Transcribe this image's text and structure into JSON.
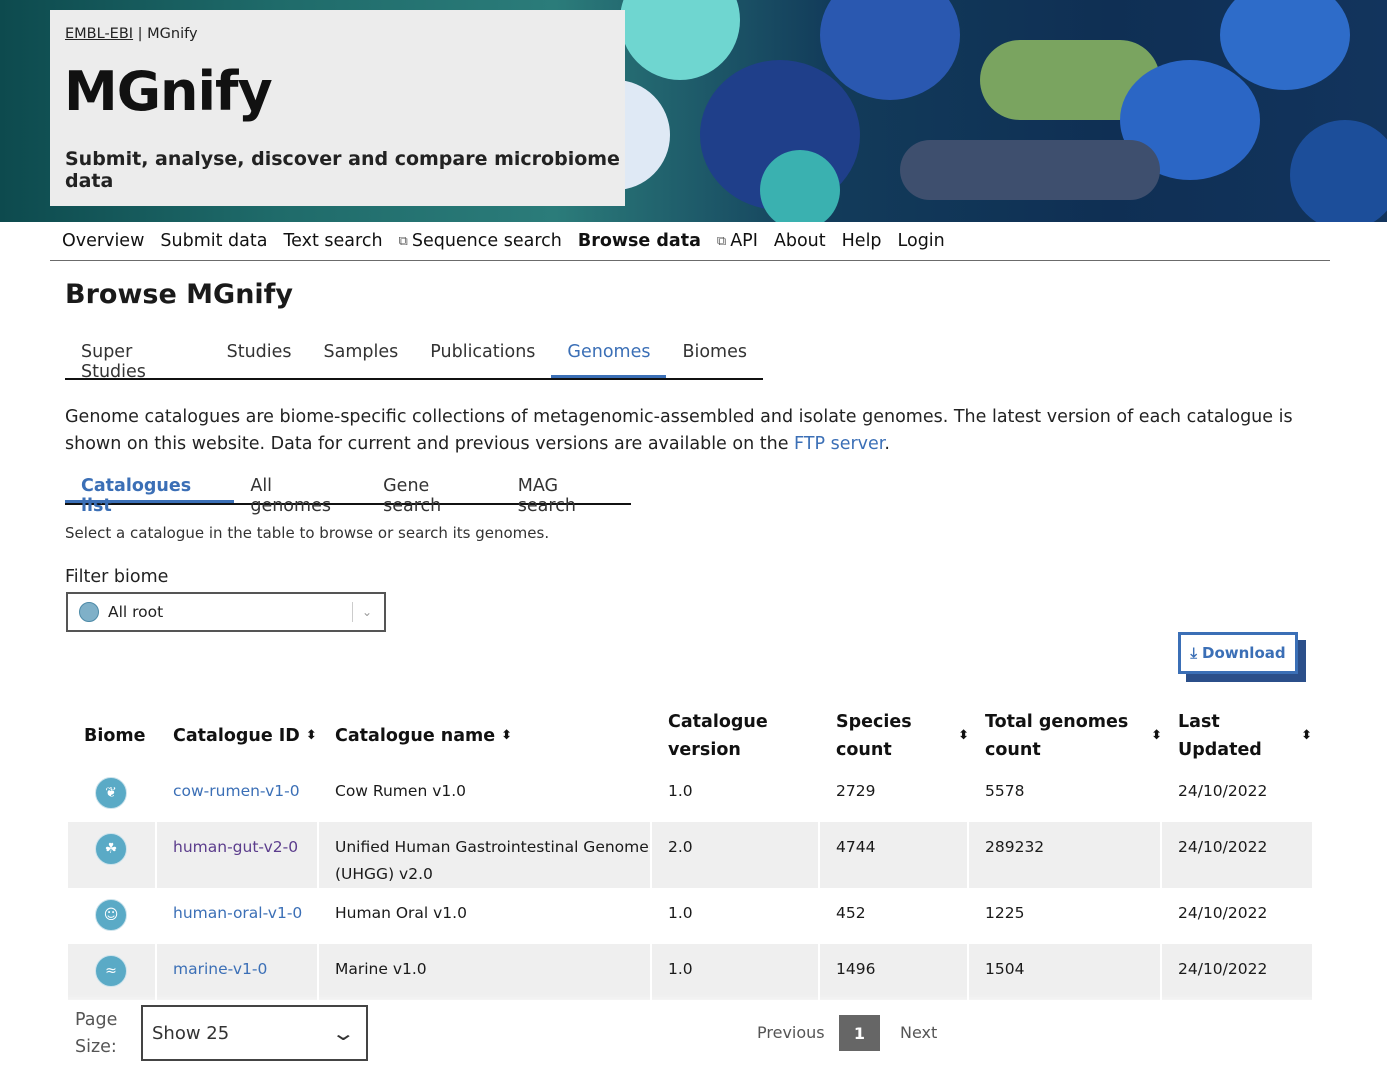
{
  "header": {
    "crumb_org": "EMBL-EBI",
    "crumb_sep": "|",
    "crumb_site": "MGnify",
    "logo_text": "MGnify",
    "tagline": "Submit, analyse, discover and compare microbiome data"
  },
  "nav": [
    {
      "label": "Overview",
      "external": false,
      "active": false
    },
    {
      "label": "Submit data",
      "external": false,
      "active": false
    },
    {
      "label": "Text search",
      "external": false,
      "active": false
    },
    {
      "label": "Sequence search",
      "external": true,
      "active": false
    },
    {
      "label": "Browse data",
      "external": false,
      "active": true
    },
    {
      "label": "API",
      "external": true,
      "active": false
    },
    {
      "label": "About",
      "external": false,
      "active": false
    },
    {
      "label": "Help",
      "external": false,
      "active": false
    },
    {
      "label": "Login",
      "external": false,
      "active": false
    }
  ],
  "page_title": "Browse MGnify",
  "tabs": [
    "Super Studies",
    "Studies",
    "Samples",
    "Publications",
    "Genomes",
    "Biomes"
  ],
  "active_tab": "Genomes",
  "intro": {
    "text": "Genome catalogues are biome-specific collections of metagenomic-assembled and isolate genomes. The latest version of each catalogue is shown on this website. Data for current and previous versions are available on the ",
    "link": "FTP server",
    "end": "."
  },
  "subtabs": [
    "Catalogues list",
    "All genomes",
    "Gene search",
    "MAG search"
  ],
  "active_subtab": "Catalogues list",
  "help_text": "Select a catalogue in the table to browse or search its genomes.",
  "filter": {
    "label": "Filter biome",
    "value": "All root"
  },
  "download_label": "Download",
  "table": {
    "headers": [
      {
        "label": "Biome",
        "sortable": false
      },
      {
        "label": "Catalogue ID",
        "sortable": true
      },
      {
        "label": "Catalogue name",
        "sortable": true
      },
      {
        "label": "Catalogue version",
        "sortable": false
      },
      {
        "label": "Species count",
        "sortable": true
      },
      {
        "label": "Total genomes count",
        "sortable": true
      },
      {
        "label": "Last Updated",
        "sortable": true
      }
    ],
    "rows": [
      {
        "biome_icon": "cow-icon",
        "id": "cow-rumen-v1-0",
        "name": "Cow Rumen v1.0",
        "version": "1.0",
        "species": "2729",
        "total": "5578",
        "updated": "24/10/2022"
      },
      {
        "biome_icon": "human-gut-icon",
        "id": "human-gut-v2-0",
        "name": "Unified Human Gastrointestinal Genome (UHGG) v2.0",
        "version": "2.0",
        "species": "4744",
        "total": "289232",
        "updated": "24/10/2022"
      },
      {
        "biome_icon": "human-oral-icon",
        "id": "human-oral-v1-0",
        "name": "Human Oral v1.0",
        "version": "1.0",
        "species": "452",
        "total": "1225",
        "updated": "24/10/2022"
      },
      {
        "biome_icon": "marine-icon",
        "id": "marine-v1-0",
        "name": "Marine v1.0",
        "version": "1.0",
        "species": "1496",
        "total": "1504",
        "updated": "24/10/2022"
      }
    ]
  },
  "pager": {
    "label": "Page Size:",
    "page_size": "Show 25",
    "previous": "Previous",
    "current": "1",
    "next": "Next"
  },
  "colors": {
    "accent": "#3b6fb6",
    "biome_icon_bg": "#5aaac6"
  }
}
